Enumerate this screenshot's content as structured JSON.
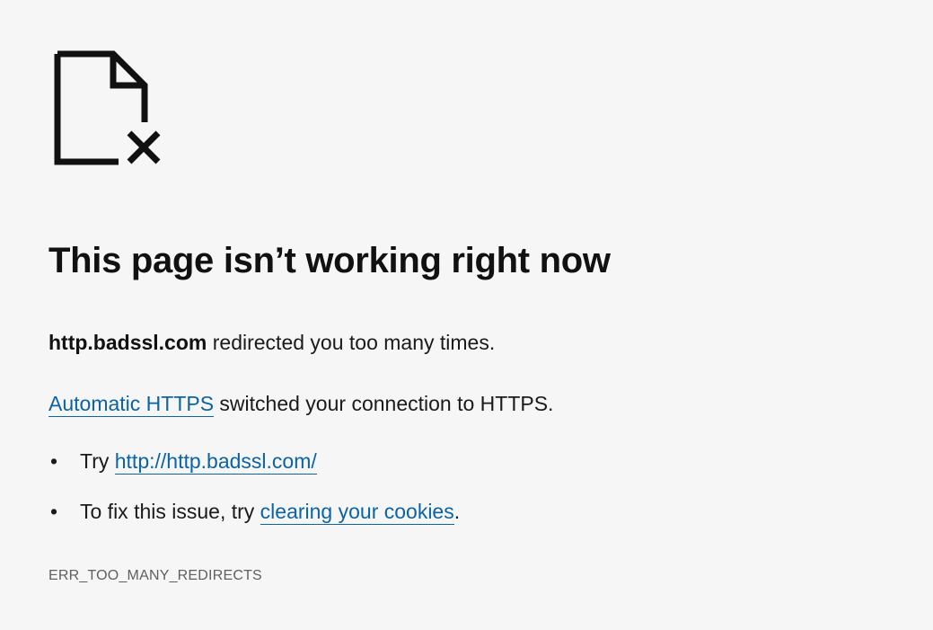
{
  "icons": {
    "error_icon": "broken-page-icon"
  },
  "colors": {
    "background": "#f6f6f6",
    "text": "#111111",
    "link": "#0b63a8",
    "error_code": "#5f5f5f"
  },
  "heading": "This page isn’t working right now",
  "redirect_message": {
    "host": "http.badssl.com",
    "text": " redirected you too many times."
  },
  "https_message": {
    "link_text": "Automatic HTTPS",
    "text": " switched your connection to HTTPS."
  },
  "suggestions": [
    {
      "bullet": "•",
      "prefix": "Try ",
      "link_text": "http://http.badssl.com/",
      "suffix": ""
    },
    {
      "bullet": "•",
      "prefix": "To fix this issue, try ",
      "link_text": "clearing your cookies",
      "suffix": "."
    }
  ],
  "error_code": "ERR_TOO_MANY_REDIRECTS"
}
